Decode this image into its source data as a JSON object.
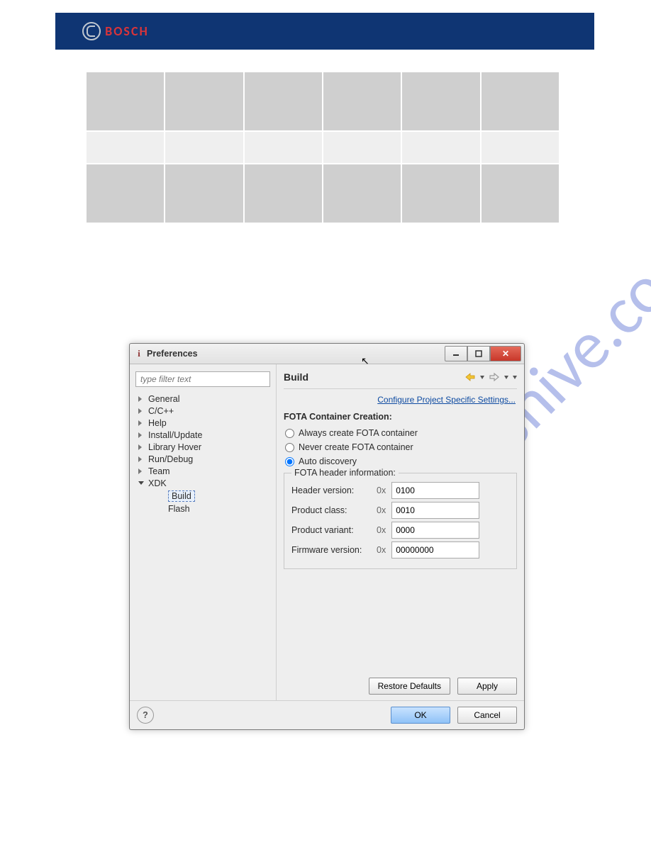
{
  "brand": {
    "name": "BOSCH"
  },
  "watermark": "manualshive.com",
  "dialog": {
    "title": "Preferences",
    "filter_placeholder": "type filter text",
    "tree": {
      "items": [
        {
          "label": "General"
        },
        {
          "label": "C/C++"
        },
        {
          "label": "Help"
        },
        {
          "label": "Install/Update"
        },
        {
          "label": "Library Hover"
        },
        {
          "label": "Run/Debug"
        },
        {
          "label": "Team"
        },
        {
          "label": "XDK",
          "expanded": true,
          "children": [
            {
              "label": "Build",
              "selected": true
            },
            {
              "label": "Flash"
            }
          ]
        }
      ]
    },
    "right": {
      "title": "Build",
      "config_link": "Configure Project Specific Settings...",
      "group_title": "FOTA Container Creation:",
      "radios": {
        "always": "Always create FOTA container",
        "never": "Never create FOTA container",
        "auto": "Auto discovery"
      },
      "fota_legend": "FOTA header information:",
      "fota": {
        "prefix": "0x",
        "header_version": {
          "label": "Header version:",
          "value": "0100"
        },
        "product_class": {
          "label": "Product class:",
          "value": "0010"
        },
        "product_variant": {
          "label": "Product variant:",
          "value": "0000"
        },
        "firmware_version": {
          "label": "Firmware version:",
          "value": "00000000"
        }
      }
    },
    "buttons": {
      "restore_defaults": "Restore Defaults",
      "apply": "Apply",
      "ok": "OK",
      "cancel": "Cancel"
    }
  }
}
